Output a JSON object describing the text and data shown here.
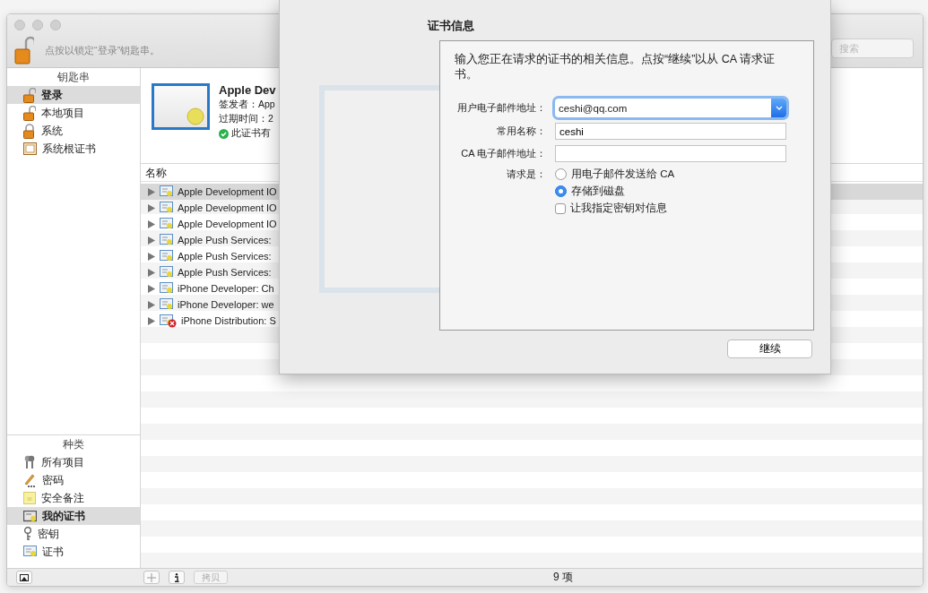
{
  "window": {
    "lock_message": "点按以锁定“登录”钥匙串。",
    "search": {
      "placeholder": "搜索"
    }
  },
  "sidebar": {
    "keychains": {
      "title": "钥匙串",
      "items": [
        {
          "label": "登录",
          "kind": "unlocked",
          "selected": true
        },
        {
          "label": "本地项目",
          "kind": "unlocked",
          "selected": false
        },
        {
          "label": "系统",
          "kind": "locked",
          "selected": false
        },
        {
          "label": "系统根证书",
          "kind": "cabinet",
          "selected": false
        }
      ]
    },
    "categories": {
      "title": "种类",
      "items": [
        {
          "label": "所有项目",
          "kind": "keys",
          "selected": false
        },
        {
          "label": "密码",
          "kind": "pencil",
          "selected": false
        },
        {
          "label": "安全备注",
          "kind": "note",
          "selected": false
        },
        {
          "label": "我的证书",
          "kind": "mycert",
          "selected": true
        },
        {
          "label": "密钥",
          "kind": "key",
          "selected": false
        },
        {
          "label": "证书",
          "kind": "cert",
          "selected": false
        }
      ]
    }
  },
  "certificate": {
    "name": "Apple Dev",
    "issuer": "签发者：App",
    "expires": "过期时间：2",
    "status": "此证书有"
  },
  "table": {
    "columns": [
      "名称"
    ],
    "rows": [
      {
        "name": "Apple Development IO",
        "selected": true,
        "error": false
      },
      {
        "name": "Apple Development IO",
        "selected": false,
        "error": false
      },
      {
        "name": "Apple Development IO",
        "selected": false,
        "error": false
      },
      {
        "name": "Apple Push Services:",
        "selected": false,
        "error": false
      },
      {
        "name": "Apple Push Services:",
        "selected": false,
        "error": false
      },
      {
        "name": "Apple Push Services:",
        "selected": false,
        "error": false
      },
      {
        "name": "iPhone Developer: Ch",
        "selected": false,
        "error": false
      },
      {
        "name": "iPhone Developer: we",
        "selected": false,
        "error": false
      },
      {
        "name": "iPhone Distribution: S",
        "selected": false,
        "error": true
      }
    ]
  },
  "bottom_bar": {
    "copy_button": {
      "label": "拷贝",
      "disabled": true
    },
    "count": "9 项"
  },
  "sheet": {
    "title": "证书信息",
    "description": "输入您正在请求的证书的相关信息。点按“继续”以从 CA 请求证书。",
    "fields": [
      {
        "label": "用户电子邮件地址：",
        "value": "ceshi@qq.com",
        "kind": "combo"
      },
      {
        "label": "常用名称：",
        "value": "ceshi",
        "kind": "text"
      },
      {
        "label": "CA 电子邮件地址：",
        "kind": "text"
      }
    ],
    "request": {
      "label": "请求是：",
      "options": [
        {
          "label": "用电子邮件发送给 CA",
          "selected": false
        },
        {
          "label": "存储到磁盘",
          "selected": true
        }
      ]
    },
    "key_pair": {
      "label": "让我指定密钥对信息",
      "checked": false
    },
    "continue_button": "继续"
  }
}
